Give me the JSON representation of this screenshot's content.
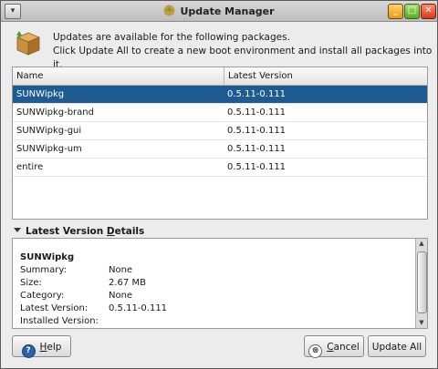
{
  "window": {
    "title": "Update Manager",
    "menu_glyph": "▾",
    "minimize_glyph": "_",
    "maximize_glyph": "□",
    "close_glyph": "✕"
  },
  "header": {
    "icon": "package-box-icon",
    "line1": "Updates are available for the following packages.",
    "line2": "Click Update All to create a new boot environment and install all packages into it."
  },
  "table": {
    "columns": [
      "Name",
      "Latest Version"
    ],
    "rows": [
      {
        "name": "SUNWipkg",
        "version": "0.5.11-0.111",
        "selected": true
      },
      {
        "name": "SUNWipkg-brand",
        "version": "0.5.11-0.111"
      },
      {
        "name": "SUNWipkg-gui",
        "version": "0.5.11-0.111"
      },
      {
        "name": "SUNWipkg-um",
        "version": "0.5.11-0.111"
      },
      {
        "name": "entire",
        "version": "0.5.11-0.111"
      }
    ]
  },
  "details": {
    "header_prefix": "Latest Version ",
    "header_underlined": "D",
    "header_suffix": "etails",
    "package": "SUNWipkg",
    "fields": [
      {
        "label": "Summary:",
        "value": "None"
      },
      {
        "label": "Size:",
        "value": "2.67 MB"
      },
      {
        "label": "Category:",
        "value": "None"
      },
      {
        "label": "Latest Version:",
        "value": "0.5.11-0.111"
      },
      {
        "label": "Installed Version:",
        "value": ""
      }
    ]
  },
  "buttons": {
    "help_mnemonic": "H",
    "help_rest": "elp",
    "cancel_mnemonic": "C",
    "cancel_rest": "ancel",
    "update_all": "Update All"
  },
  "colors": {
    "selection": "#1e5b92"
  }
}
